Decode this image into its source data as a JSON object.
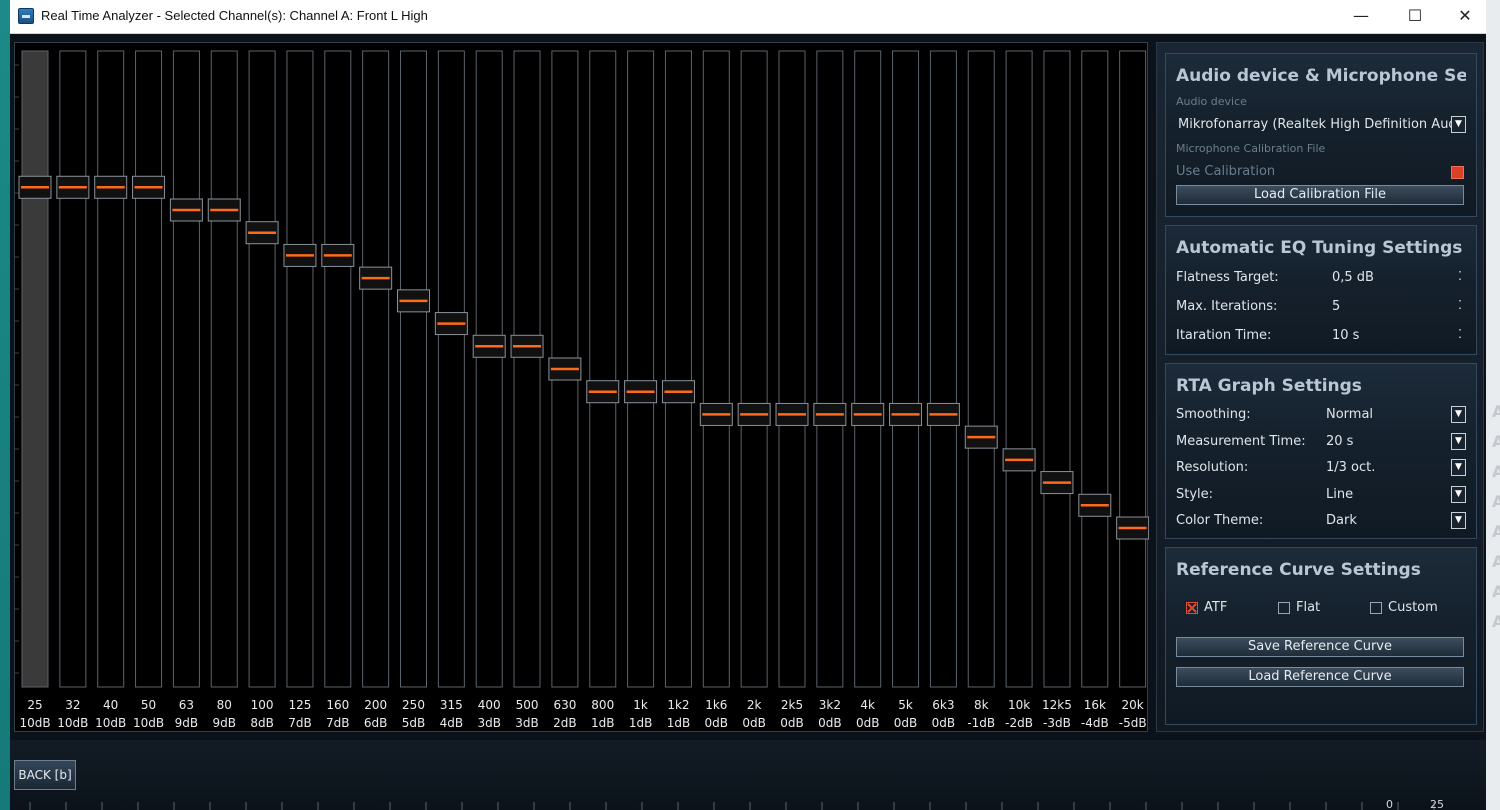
{
  "window": {
    "title": "Real Time Analyzer - Selected Channel(s): Channel A: Front L High",
    "minimize_glyph": "—",
    "maximize_glyph": "☐",
    "close_glyph": "✕"
  },
  "eq": {
    "gain_range_db": [
      -12,
      16
    ],
    "selected_band": 0,
    "bands": [
      {
        "freq": "25",
        "gain_label": "10dB",
        "gain_db": 10
      },
      {
        "freq": "32",
        "gain_label": "10dB",
        "gain_db": 10
      },
      {
        "freq": "40",
        "gain_label": "10dB",
        "gain_db": 10
      },
      {
        "freq": "50",
        "gain_label": "10dB",
        "gain_db": 10
      },
      {
        "freq": "63",
        "gain_label": "9dB",
        "gain_db": 9
      },
      {
        "freq": "80",
        "gain_label": "9dB",
        "gain_db": 9
      },
      {
        "freq": "100",
        "gain_label": "8dB",
        "gain_db": 8
      },
      {
        "freq": "125",
        "gain_label": "7dB",
        "gain_db": 7
      },
      {
        "freq": "160",
        "gain_label": "7dB",
        "gain_db": 7
      },
      {
        "freq": "200",
        "gain_label": "6dB",
        "gain_db": 6
      },
      {
        "freq": "250",
        "gain_label": "5dB",
        "gain_db": 5
      },
      {
        "freq": "315",
        "gain_label": "4dB",
        "gain_db": 4
      },
      {
        "freq": "400",
        "gain_label": "3dB",
        "gain_db": 3
      },
      {
        "freq": "500",
        "gain_label": "3dB",
        "gain_db": 3
      },
      {
        "freq": "630",
        "gain_label": "2dB",
        "gain_db": 2
      },
      {
        "freq": "800",
        "gain_label": "1dB",
        "gain_db": 1
      },
      {
        "freq": "1k",
        "gain_label": "1dB",
        "gain_db": 1
      },
      {
        "freq": "1k2",
        "gain_label": "1dB",
        "gain_db": 1
      },
      {
        "freq": "1k6",
        "gain_label": "0dB",
        "gain_db": 0
      },
      {
        "freq": "2k",
        "gain_label": "0dB",
        "gain_db": 0
      },
      {
        "freq": "2k5",
        "gain_label": "0dB",
        "gain_db": 0
      },
      {
        "freq": "3k2",
        "gain_label": "0dB",
        "gain_db": 0
      },
      {
        "freq": "4k",
        "gain_label": "0dB",
        "gain_db": 0
      },
      {
        "freq": "5k",
        "gain_label": "0dB",
        "gain_db": 0
      },
      {
        "freq": "6k3",
        "gain_label": "0dB",
        "gain_db": 0
      },
      {
        "freq": "8k",
        "gain_label": "-1dB",
        "gain_db": -1
      },
      {
        "freq": "10k",
        "gain_label": "-2dB",
        "gain_db": -2
      },
      {
        "freq": "12k5",
        "gain_label": "-3dB",
        "gain_db": -3
      },
      {
        "freq": "16k",
        "gain_label": "-4dB",
        "gain_db": -4
      },
      {
        "freq": "20k",
        "gain_label": "-5dB",
        "gain_db": -5
      }
    ],
    "colors": {
      "handle_line": "#ff6a1a",
      "selected_track": "#3a3a3a"
    }
  },
  "audio": {
    "title": "Audio device & Microphone Settings",
    "device_label": "Audio device",
    "device_value": "Mikrofonarray (Realtek High Definition Audio)",
    "calib_file_label": "Microphone Calibration File",
    "use_calibration_label": "Use Calibration",
    "load_calibration_label": "Load Calibration File",
    "dropdown_glyph": "▼"
  },
  "auto_eq": {
    "title": "Automatic EQ Tuning Settings",
    "rows": [
      {
        "label": "Flatness Target:",
        "value": "0,5 dB"
      },
      {
        "label": "Max. Iterations:",
        "value": "5"
      },
      {
        "label": "Itaration Time:",
        "value": "10 s"
      }
    ],
    "spin_glyph": "⁚"
  },
  "rta": {
    "title": "RTA Graph Settings",
    "rows": [
      {
        "label": "Smoothing:",
        "value": "Normal"
      },
      {
        "label": "Measurement Time:",
        "value": "20 s"
      },
      {
        "label": "Resolution:",
        "value": "1/3 oct."
      },
      {
        "label": "Style:",
        "value": "Line"
      },
      {
        "label": "Color Theme:",
        "value": "Dark"
      }
    ],
    "dropdown_glyph": "▼"
  },
  "reference": {
    "title": "Reference Curve Settings",
    "options": [
      {
        "label": "ATF",
        "checked": true
      },
      {
        "label": "Flat",
        "checked": false
      },
      {
        "label": "Custom",
        "checked": false
      }
    ],
    "save_label": "Save Reference Curve",
    "load_label": "Load Reference Curve"
  },
  "footer": {
    "back_label": "BACK [b]",
    "num_left": "0",
    "num_right": "25"
  }
}
